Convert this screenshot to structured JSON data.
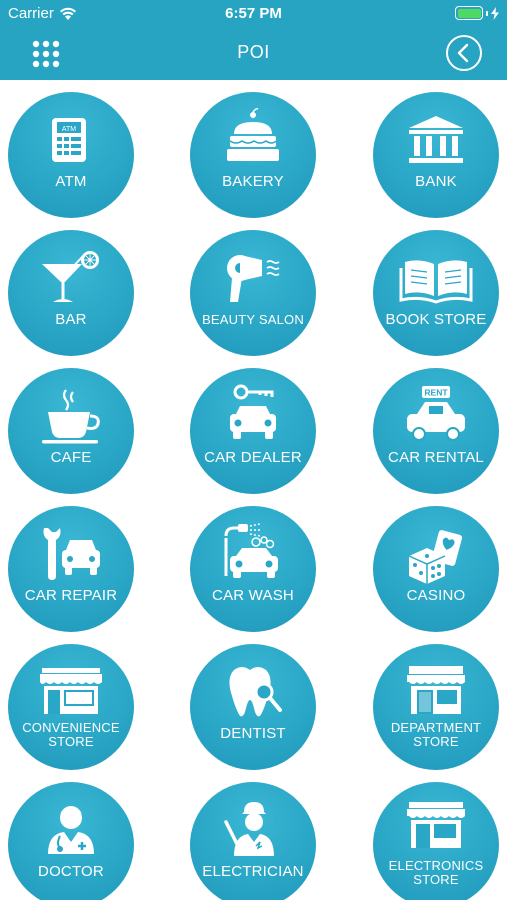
{
  "status": {
    "carrier": "Carrier",
    "time": "6:57 PM"
  },
  "nav": {
    "title": "POI"
  },
  "icons": {
    "menu": "grid-dots-icon",
    "back": "chevron-left-circle-icon"
  },
  "colors": {
    "header": "#26a4c2",
    "tile": "#2aa6c6",
    "battery": "#4cd964"
  },
  "categories": [
    {
      "label": "ATM",
      "icon": "atm-icon"
    },
    {
      "label": "BAKERY",
      "icon": "cake-icon"
    },
    {
      "label": "BANK",
      "icon": "bank-icon"
    },
    {
      "label": "BAR",
      "icon": "cocktail-icon"
    },
    {
      "label": "BEAUTY SALON",
      "icon": "hair-dryer-icon"
    },
    {
      "label": "BOOK STORE",
      "icon": "open-book-icon"
    },
    {
      "label": "CAFE",
      "icon": "coffee-cup-icon"
    },
    {
      "label": "CAR DEALER",
      "icon": "car-key-icon"
    },
    {
      "label": "CAR RENTAL",
      "icon": "rent-car-icon"
    },
    {
      "label": "CAR REPAIR",
      "icon": "wrench-car-icon"
    },
    {
      "label": "CAR WASH",
      "icon": "car-wash-icon"
    },
    {
      "label": "CASINO",
      "icon": "dice-cards-icon"
    },
    {
      "label": "CONVENIENCE\nSTORE",
      "icon": "storefront-icon"
    },
    {
      "label": "DENTIST",
      "icon": "tooth-icon"
    },
    {
      "label": "DEPARTMENT\nSTORE",
      "icon": "department-store-icon"
    },
    {
      "label": "DOCTOR",
      "icon": "doctor-icon"
    },
    {
      "label": "ELECTRICIAN",
      "icon": "electrician-icon"
    },
    {
      "label": "ELECTRONICS\nSTORE",
      "icon": "electronics-store-icon"
    }
  ]
}
